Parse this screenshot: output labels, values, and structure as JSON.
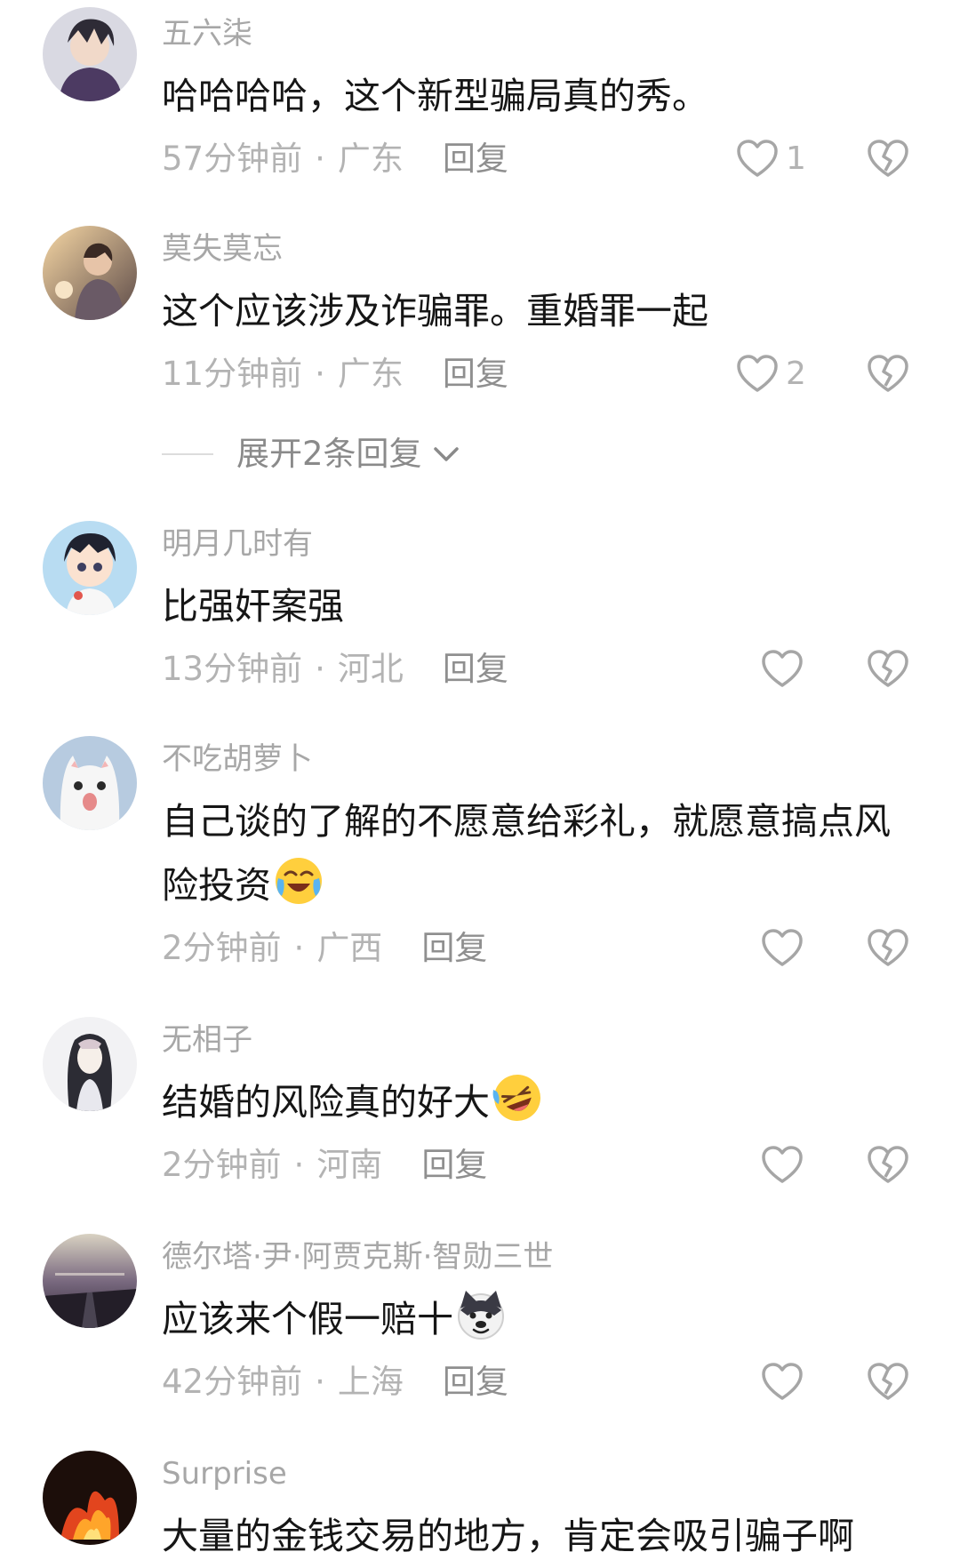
{
  "comments": [
    {
      "username": "五六柒",
      "text": "哈哈哈哈，这个新型骗局真的秀。",
      "time": "57分钟前",
      "location": "广东",
      "reply": "回复",
      "likes": "1"
    },
    {
      "username": "莫失莫忘",
      "text": "这个应该涉及诈骗罪。重婚罪一起",
      "time": "11分钟前",
      "location": "广东",
      "reply": "回复",
      "likes": "2"
    },
    {
      "username": "明月几时有",
      "text": "比强奸案强",
      "time": "13分钟前",
      "location": "河北",
      "reply": "回复",
      "likes": ""
    },
    {
      "username": "不吃胡萝卜",
      "text": "自己谈的了解的不愿意给彩礼，就愿意搞点风险投资",
      "emoji": "crying-laughing-emoji",
      "time": "2分钟前",
      "location": "广西",
      "reply": "回复",
      "likes": ""
    },
    {
      "username": "无相子",
      "text": "结婚的风险真的好大",
      "emoji": "rolling-laughing-emoji",
      "time": "2分钟前",
      "location": "河南",
      "reply": "回复",
      "likes": ""
    },
    {
      "username": "德尔塔·尹·阿贾克斯·智勋三世",
      "text": "应该来个假一赔十",
      "emoji": "doge-emoji",
      "time": "42分钟前",
      "location": "上海",
      "reply": "回复",
      "likes": ""
    },
    {
      "username": "Surprise",
      "text": "大量的金钱交易的地方，肯定会吸引骗子啊"
    }
  ],
  "expand_replies": "展开2条回复",
  "meta_separator": "·",
  "colors": {
    "meta": "#b3b3b3",
    "username": "#a7a7a7",
    "text": "#161616",
    "reply": "#8f8f8f"
  }
}
